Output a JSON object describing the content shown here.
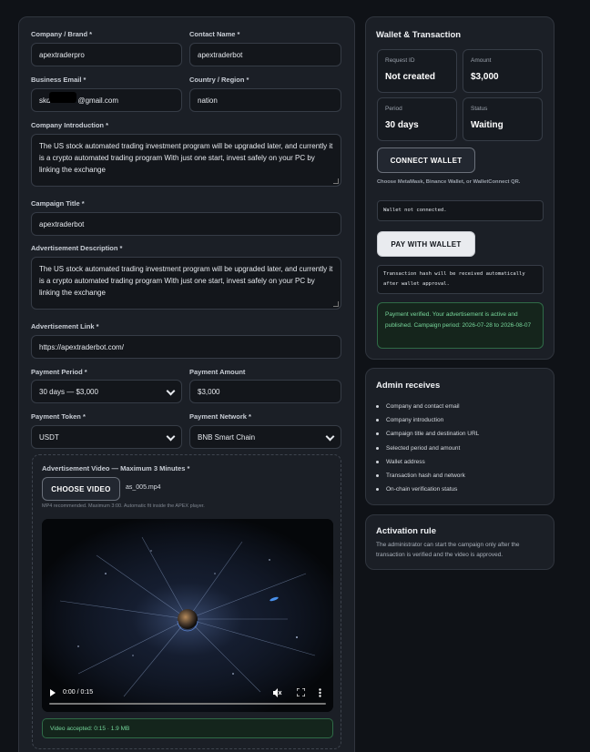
{
  "form": {
    "company_label": "Company / Brand *",
    "company_value": "apextraderpro",
    "contact_label": "Contact Name *",
    "contact_value": "apextraderbot",
    "email_label": "Business Email *",
    "email_prefix": "skd",
    "email_suffix": "@gmail.com",
    "country_label": "Country / Region *",
    "country_value": "nation",
    "intro_label": "Company Introduction *",
    "intro_value": "The US stock automated trading investment program will be upgraded later, and currently it is a crypto automated trading program With just one start, invest safely on your PC by linking the exchange",
    "campaign_label": "Campaign Title *",
    "campaign_value": "apextraderbot",
    "ad_desc_label": "Advertisement Description *",
    "ad_desc_value": "The US stock automated trading investment program will be upgraded later, and currently it is a crypto automated trading program With just one start, invest safely on your PC by linking the exchange",
    "ad_link_label": "Advertisement Link *",
    "ad_link_value": "https://apextraderbot.com/",
    "period_label": "Payment Period *",
    "period_value": "30 days — $3,000",
    "amount_label": "Payment Amount",
    "amount_value": "$3,000",
    "token_label": "Payment Token *",
    "token_value": "USDT",
    "network_label": "Payment Network *",
    "network_value": "BNB Smart Chain"
  },
  "video": {
    "label": "Advertisement Video — Maximum 3 Minutes *",
    "choose_label": "CHOOSE VIDEO",
    "file_name": "as_005.mp4",
    "hint": "MP4 recommended. Maximum 3:00. Automatic fit inside the APEX player.",
    "time": "0:00 / 0:15",
    "accepted": "Video accepted: 0:15 · 1.9 MB"
  },
  "wallet": {
    "title": "Wallet & Transaction",
    "request_id_label": "Request ID",
    "request_id_value": "Not created",
    "amount_label": "Amount",
    "amount_value": "$3,000",
    "period_label": "Period",
    "period_value": "30 days",
    "status_label": "Status",
    "status_value": "Waiting",
    "connect_label": "CONNECT WALLET",
    "connect_hint": "Choose MetaMask, Binance Wallet, or WalletConnect QR.",
    "wallet_status": "Wallet not connected.",
    "pay_label": "PAY WITH WALLET",
    "tx_hint": "Transaction hash will be received automatically after wallet approval.",
    "verified": "Payment verified. Your advertisement is active and published. Campaign period: 2026-07-28 to 2026-08-07"
  },
  "admin": {
    "title": "Admin receives",
    "items": [
      "Company and contact email",
      "Company introduction",
      "Campaign title and destination URL",
      "Selected period and amount",
      "Wallet address",
      "Transaction hash and network",
      "On-chain verification status"
    ]
  },
  "activation": {
    "title": "Activation rule",
    "text": "The administrator can start the campaign only after the transaction is verified and the video is approved."
  },
  "colors": {
    "background": "#0f1217",
    "panel": "#1b1f26",
    "success": "#78d89b"
  }
}
